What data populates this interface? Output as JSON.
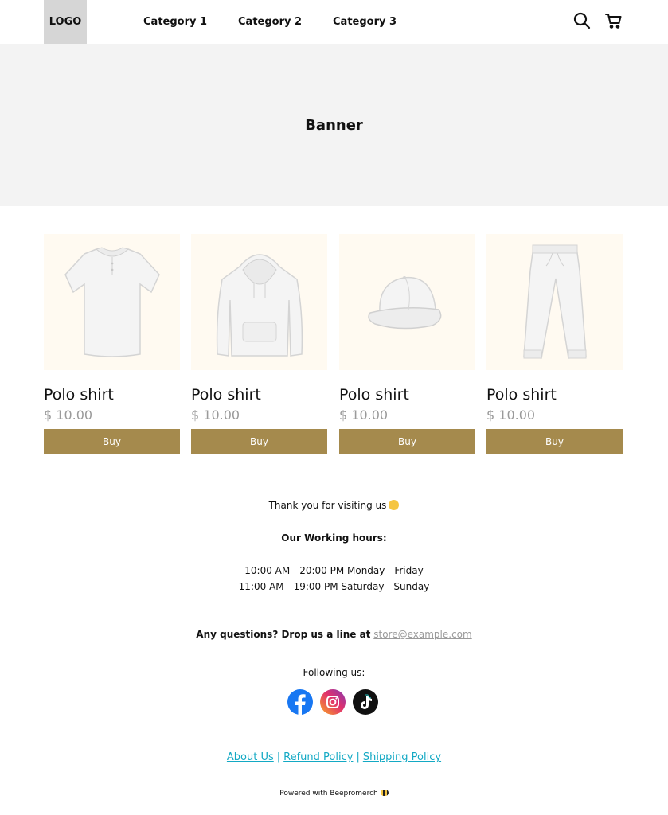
{
  "header": {
    "logo": "LOGO",
    "nav": [
      "Category 1",
      "Category 2",
      "Category 3"
    ],
    "search_icon": "search-icon",
    "cart_icon": "cart-icon"
  },
  "banner": {
    "title": "Banner"
  },
  "products": [
    {
      "title": "Polo shirt",
      "price": "$ 10.00",
      "button": "Buy",
      "image": "polo-shirt-image"
    },
    {
      "title": "Polo shirt",
      "price": "$ 10.00",
      "button": "Buy",
      "image": "hoodie-image"
    },
    {
      "title": "Polo shirt",
      "price": "$ 10.00",
      "button": "Buy",
      "image": "cap-image"
    },
    {
      "title": "Polo shirt",
      "price": "$ 10.00",
      "button": "Buy",
      "image": "sweatpants-image"
    }
  ],
  "footer": {
    "thanks": "Thank you for visiting us",
    "hours_title": "Our Working hours:",
    "hours": [
      "10:00 AM - 20:00 PM Monday - Friday",
      "11:00 AM - 19:00 PM Saturday - Sunday"
    ],
    "questions_label": "Any questions? Drop us a line at",
    "email": "store@example.com",
    "following": "Following us:",
    "socials": [
      "facebook-icon",
      "instagram-icon",
      "tiktok-icon"
    ],
    "links": [
      "About Us",
      "Refund Policy",
      "Shipping Policy"
    ],
    "powered": "Powered with Beepromerch"
  },
  "colors": {
    "buy_button": "#a58a4d",
    "banner_bg": "#f3f3f3",
    "product_bg": "#fffaf1",
    "link": "#13a9c4",
    "price": "#9a9a9a"
  }
}
